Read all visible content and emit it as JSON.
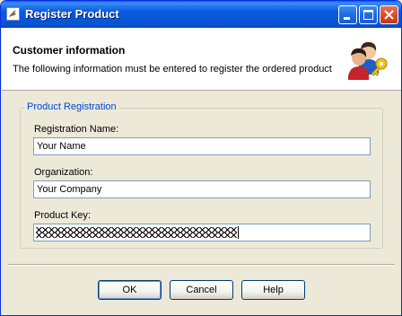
{
  "window": {
    "title": "Register Product",
    "controls": [
      "minimize-icon",
      "maximize-icon",
      "close-icon"
    ]
  },
  "header": {
    "title": "Customer information",
    "description": "The following information must be entered to register the ordered product",
    "icon": "users-key-icon"
  },
  "group": {
    "legend": "Product Registration",
    "fields": {
      "registration_name": {
        "label": "Registration Name:",
        "value": "Your Name"
      },
      "organization": {
        "label": "Organization:",
        "value": "Your Company"
      },
      "product_key": {
        "label": "Product Key:",
        "masked": true
      }
    }
  },
  "buttons": {
    "ok": "OK",
    "cancel": "Cancel",
    "help": "Help"
  },
  "colors": {
    "titlebar": "#0a5ae0",
    "legend": "#0046d5",
    "dialog_bg": "#ece9d8"
  }
}
